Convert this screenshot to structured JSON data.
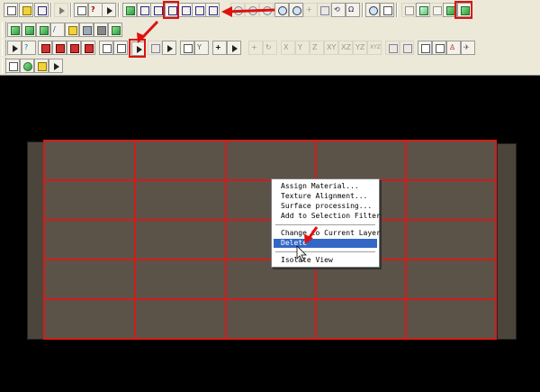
{
  "toolbar": {
    "rows": 4
  },
  "context_menu": {
    "items": [
      "Assign Material...",
      "Texture Alignment...",
      "Surface processing...",
      "Add to Selection Filter",
      "Change to Current Layer",
      "Delete",
      "Isolate View"
    ],
    "active_item": "Delete"
  },
  "axis_buttons": [
    "X",
    "Y",
    "Z",
    "XY",
    "XZ",
    "YZ",
    "XYZ"
  ],
  "colors": {
    "highlight": "#e01010",
    "slab": "#5b5348",
    "grid": "#d21c1c",
    "menu_active": "#3367c6"
  }
}
